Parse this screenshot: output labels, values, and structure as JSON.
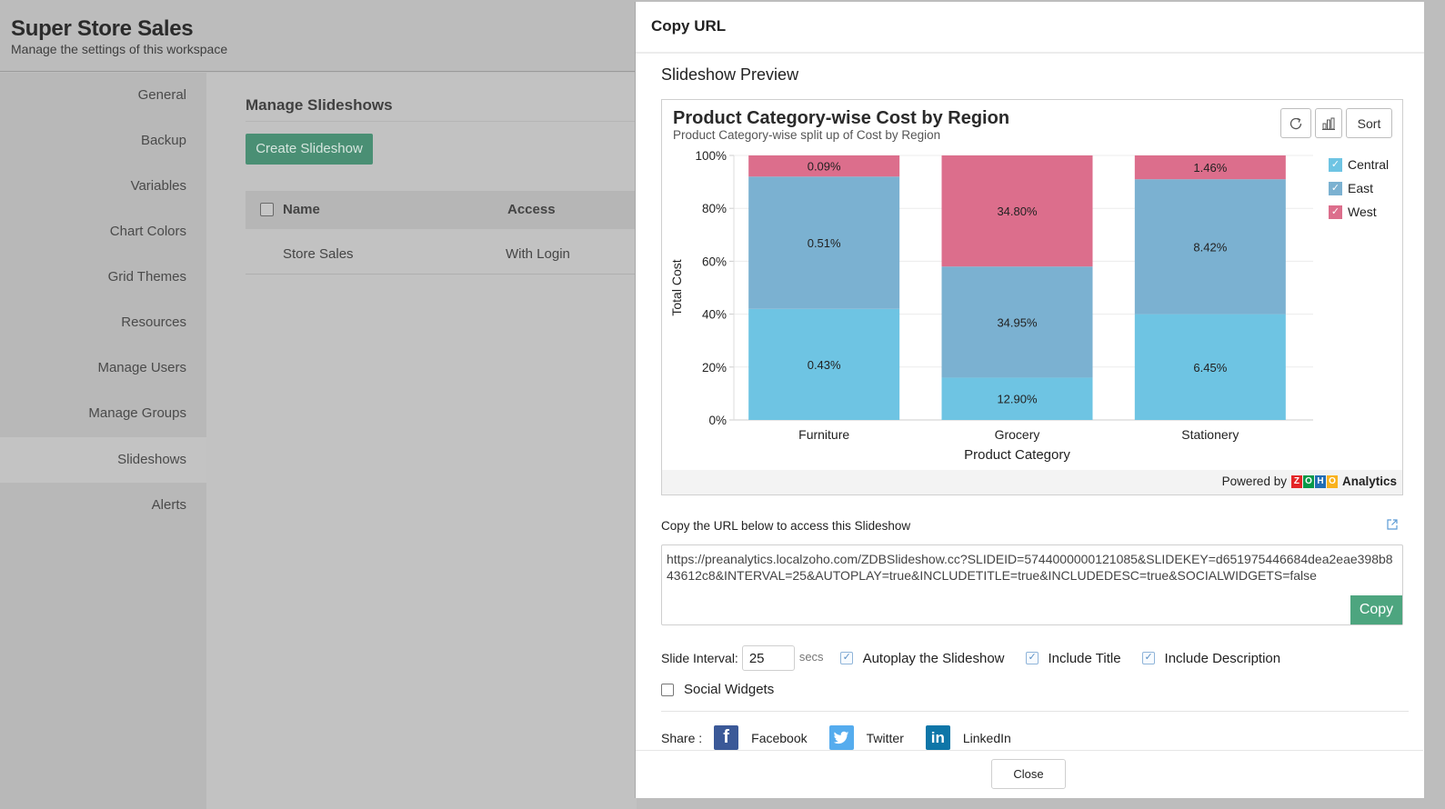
{
  "workspace": {
    "title": "Super Store Sales",
    "subtitle": "Manage the settings of this workspace"
  },
  "sidebar": {
    "items": [
      {
        "label": "General"
      },
      {
        "label": "Backup"
      },
      {
        "label": "Variables"
      },
      {
        "label": "Chart Colors"
      },
      {
        "label": "Grid Themes"
      },
      {
        "label": "Resources"
      },
      {
        "label": "Manage Users"
      },
      {
        "label": "Manage Groups"
      },
      {
        "label": "Slideshows",
        "active": true
      },
      {
        "label": "Alerts"
      }
    ]
  },
  "main": {
    "title": "Manage Slideshows",
    "create_button": "Create Slideshow",
    "table": {
      "columns": [
        "Name",
        "Access"
      ],
      "rows": [
        {
          "name": "Store Sales",
          "access": "With Login"
        }
      ]
    }
  },
  "dialog": {
    "title": "Copy URL",
    "preview_label": "Slideshow Preview",
    "toolbar": {
      "refresh_icon": "refresh-icon",
      "chart_type_icon": "bar-chart-icon",
      "sort_label": "Sort"
    },
    "powered_by": "Powered by",
    "brand_letters": [
      "Z",
      "O",
      "H",
      "O"
    ],
    "brand_colors": [
      "#e42527",
      "#089949",
      "#226db4",
      "#f9b21d"
    ],
    "brand_product": "Analytics",
    "url_label": "Copy the URL below to access this Slideshow",
    "url_value": "https://preanalytics.localzoho.com/ZDBSlideshow.cc?SLIDEID=5744000000121085&SLIDEKEY=d651975446684dea2eae398b843612c8&INTERVAL=25&AUTOPLAY=true&INCLUDETITLE=true&INCLUDEDESC=true&SOCIALWIDGETS=false",
    "copy_button": "Copy",
    "slide_interval_label": "Slide Interval:",
    "slide_interval_value": "25",
    "secs_label": "secs",
    "options": [
      {
        "label": "Autoplay the Slideshow",
        "checked": true
      },
      {
        "label": "Include Title",
        "checked": true
      },
      {
        "label": "Include Description",
        "checked": true
      },
      {
        "label": "Social Widgets",
        "checked": false
      }
    ],
    "share_label": "Share :",
    "share": [
      {
        "label": "Facebook",
        "icon": "facebook-icon",
        "color": "#3b5998"
      },
      {
        "label": "Twitter",
        "icon": "twitter-icon",
        "color": "#55acee"
      },
      {
        "label": "LinkedIn",
        "icon": "linkedin-icon",
        "color": "#0e76a8"
      }
    ],
    "close_button": "Close"
  },
  "chart_data": {
    "type": "bar",
    "stacked": "percent",
    "title": "Product Category-wise Cost by Region",
    "subtitle": "Product Category-wise split up of Cost by Region",
    "xlabel": "Product Category",
    "ylabel": "Total Cost",
    "ylim": [
      0,
      100
    ],
    "yticks": [
      "0%",
      "20%",
      "40%",
      "60%",
      "80%",
      "100%"
    ],
    "grid": true,
    "legend_position": "right",
    "categories": [
      "Furniture",
      "Grocery",
      "Stationery"
    ],
    "series": [
      {
        "name": "Central",
        "color": "#6ec4e3",
        "values": [
          42,
          16,
          40
        ],
        "labels": [
          "0.43%",
          "12.90%",
          "6.45%"
        ]
      },
      {
        "name": "East",
        "color": "#7bb1d1",
        "values": [
          50,
          42,
          51
        ],
        "labels": [
          "0.51%",
          "34.95%",
          "8.42%"
        ]
      },
      {
        "name": "West",
        "color": "#dc6e8c",
        "values": [
          8,
          42,
          9
        ],
        "labels": [
          "0.09%",
          "34.80%",
          "1.46%"
        ]
      }
    ]
  }
}
